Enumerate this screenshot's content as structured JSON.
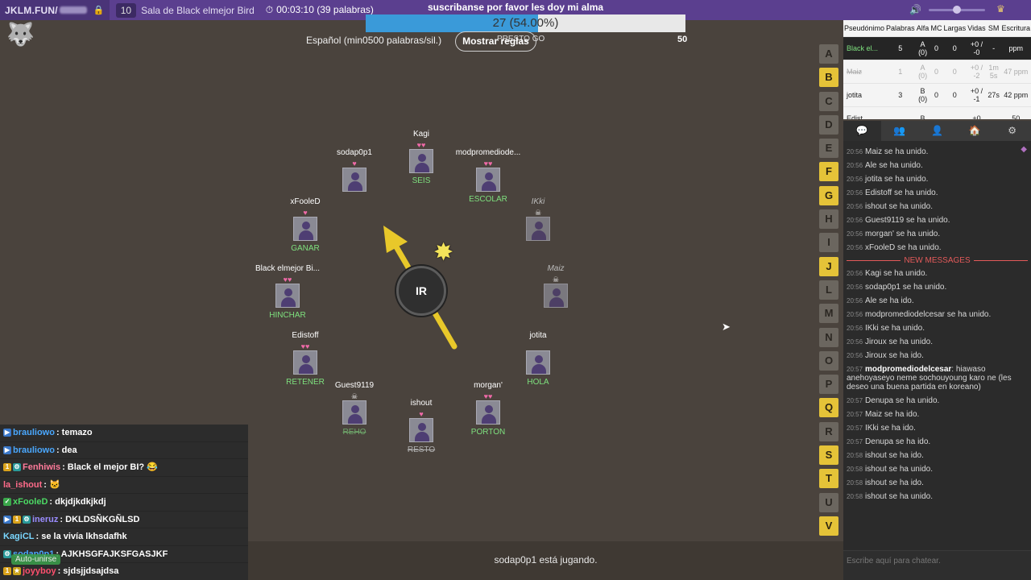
{
  "topbar": {
    "site": "JKLM.FUN/",
    "room_count": "10",
    "room_name": "Sala de Black elmejor Bird",
    "timer": "00:03:10 (39 palabras)",
    "notice": "suscribanse por favor les doy mi alma"
  },
  "progress": {
    "text": "27 (54.00%)",
    "fraction": 0.54
  },
  "rules": {
    "language": "Español (min0500 palabras/sil.)",
    "show_rules_label": "Mostrar reglas",
    "mode_text": "PRESTO GO",
    "goal": "50"
  },
  "bomb": {
    "label": "IR"
  },
  "players": [
    {
      "name": "Kagi",
      "hearts": "♥♥",
      "word": "SEIS",
      "dead": false
    },
    {
      "name": "sodap0p1",
      "hearts": "♥",
      "word": "",
      "dead": false
    },
    {
      "name": "modpromediode...",
      "hearts": "♥♥",
      "word": "ESCOLAR",
      "dead": false
    },
    {
      "name": "xFooleD",
      "hearts": "♥",
      "word": "GANAR",
      "dead": false
    },
    {
      "name": "IKki",
      "hearts": "☠",
      "word": "",
      "dead": true
    },
    {
      "name": "Black elmejor Bi...",
      "hearts": "♥♥",
      "word": "HINCHAR",
      "dead": false
    },
    {
      "name": "Maiz",
      "hearts": "☠",
      "word": "",
      "dead": true
    },
    {
      "name": "Edistoff",
      "hearts": "♥♥",
      "word": "RETENER",
      "dead": false
    },
    {
      "name": "jotita",
      "hearts": "",
      "word": "HOLA",
      "dead": false
    },
    {
      "name": "Guest9119",
      "hearts": "☠",
      "word": "REHO",
      "dead": false
    },
    {
      "name": "ishout",
      "hearts": "♥",
      "word": "RESTO",
      "dead": false
    },
    {
      "name": "morgan'",
      "hearts": "♥♥",
      "word": "PORTON",
      "dead": false
    }
  ],
  "letters": [
    {
      "l": "A",
      "on": false
    },
    {
      "l": "B",
      "on": true
    },
    {
      "l": "C",
      "on": false
    },
    {
      "l": "D",
      "on": false
    },
    {
      "l": "E",
      "on": false
    },
    {
      "l": "F",
      "on": true
    },
    {
      "l": "G",
      "on": true
    },
    {
      "l": "H",
      "on": false
    },
    {
      "l": "I",
      "on": false
    },
    {
      "l": "J",
      "on": true
    },
    {
      "l": "L",
      "on": false
    },
    {
      "l": "M",
      "on": false
    },
    {
      "l": "N",
      "on": false
    },
    {
      "l": "O",
      "on": false
    },
    {
      "l": "P",
      "on": false
    },
    {
      "l": "Q",
      "on": true
    },
    {
      "l": "R",
      "on": false
    },
    {
      "l": "S",
      "on": true
    },
    {
      "l": "T",
      "on": true
    },
    {
      "l": "U",
      "on": false
    },
    {
      "l": "V",
      "on": true
    }
  ],
  "scoreboard": {
    "headers": [
      "Pseudónimo",
      "Palabras",
      "Alfa",
      "MC",
      "Largas",
      "Vidas",
      "SM",
      "Escritura"
    ],
    "rows": [
      {
        "name": "Black el...",
        "words": "5",
        "alpha": "A (0)",
        "mc": "0",
        "long": "0",
        "lives": "+0 / -0",
        "sm": "-",
        "speed": "ppm",
        "state": "active"
      },
      {
        "name": "Maiz",
        "words": "1",
        "alpha": "A (0)",
        "mc": "0",
        "long": "0",
        "lives": "+0 / -2",
        "sm": "1m 5s",
        "speed": "47 ppm",
        "state": "dead"
      },
      {
        "name": "jotita",
        "words": "3",
        "alpha": "B (0)",
        "mc": "0",
        "long": "0",
        "lives": "+0 / -1",
        "sm": "27s",
        "speed": "42 ppm",
        "state": "normal"
      },
      {
        "name": "Edist...",
        "words": "",
        "alpha": "B",
        "mc": "",
        "long": "",
        "lives": "+0",
        "sm": "",
        "speed": "50",
        "state": "normal"
      }
    ]
  },
  "chat_tabs": [
    "💬",
    "👥",
    "👤",
    "🏠",
    "⚙"
  ],
  "right_chat": [
    {
      "t": "20:56",
      "text": "Maiz se ha unido."
    },
    {
      "t": "20:56",
      "text": "Ale se ha unido."
    },
    {
      "t": "20:56",
      "text": "jotita se ha unido."
    },
    {
      "t": "20:56",
      "text": "Edistoff se ha unido."
    },
    {
      "t": "20:56",
      "text": "ishout se ha unido."
    },
    {
      "t": "20:56",
      "text": "Guest9119 se ha unido."
    },
    {
      "t": "20:56",
      "text": "morgan' se ha unido."
    },
    {
      "t": "20:56",
      "text": "xFooleD se ha unido."
    },
    {
      "t": "",
      "text": "NEW MESSAGES",
      "divider": true
    },
    {
      "t": "20:56",
      "text": "Kagi se ha unido."
    },
    {
      "t": "20:56",
      "text": "sodap0p1 se ha unido."
    },
    {
      "t": "20:56",
      "text": "Ale se ha ido."
    },
    {
      "t": "20:56",
      "text": "modpromediodelcesar se ha unido."
    },
    {
      "t": "20:56",
      "text": "IKki se ha unido."
    },
    {
      "t": "20:56",
      "text": "Jiroux se ha unido."
    },
    {
      "t": "20:56",
      "text": "Jiroux se ha ido."
    },
    {
      "t": "20:57",
      "user": "modpromediodelcesar",
      "text": ": hiawaso anehoyaseyo neme sochouyoung karo ne (les deseo una buena partida en koreano)"
    },
    {
      "t": "20:57",
      "text": "Denupa se ha unido."
    },
    {
      "t": "20:57",
      "text": "Maiz se ha ido."
    },
    {
      "t": "20:57",
      "text": "IKki se ha ido."
    },
    {
      "t": "20:57",
      "text": "Denupa se ha ido."
    },
    {
      "t": "20:58",
      "text": "ishout se ha ido."
    },
    {
      "t": "20:58",
      "text": "ishout se ha unido."
    },
    {
      "t": "20:58",
      "text": "ishout se ha ido."
    },
    {
      "t": "20:58",
      "text": "ishout se ha unido."
    }
  ],
  "chat_input_placeholder": "Escribe aquí para chatear.",
  "left_chat": [
    {
      "user": "brauliowo",
      "text": ": temazo",
      "color": "#4aa8ff",
      "icons": [
        "▶"
      ]
    },
    {
      "user": "brauliowo",
      "text": ": dea",
      "color": "#4aa8ff",
      "icons": [
        "▶"
      ]
    },
    {
      "user": "Fenhiwis",
      "text": ": Black el mejor BI? 😂",
      "color": "#ff7a9a",
      "icons": [
        "1",
        "⚙"
      ]
    },
    {
      "user": "la_ishout",
      "text": ": 🐱",
      "color": "#ff6b8a",
      "icons": []
    },
    {
      "user": "xFooleD",
      "text": ": dkjdjkdkjkdj",
      "color": "#4cd964",
      "icons": [
        "✓"
      ]
    },
    {
      "user": "ineruz",
      "text": ": DKLDSÑKGÑLSD",
      "color": "#9a8cff",
      "icons": [
        "▶",
        "1",
        "⚙"
      ]
    },
    {
      "user": "KagiCL",
      "text": ": se la vivía lkhsdafhk",
      "color": "#7ad7ff",
      "icons": []
    },
    {
      "user": "sodap0p1",
      "text": ": AJKHSGFAJKSFGASJKF",
      "color": "#4aa8ff",
      "icons": [
        "⚙"
      ]
    },
    {
      "user": "joyyboy",
      "text": ": sjdsjjdsajdsa",
      "color": "#ff4f6e",
      "icons": [
        "1",
        "★"
      ]
    }
  ],
  "auto_join_label": "Auto-unirse",
  "bottom_status": "sodap0p1 está jugando.",
  "colors": {
    "accent": "#5b3f8f",
    "letter_on": "#e5c338",
    "heart": "#f06aa8",
    "word": "#7ee07e",
    "new_messages": "#e35a5a"
  }
}
